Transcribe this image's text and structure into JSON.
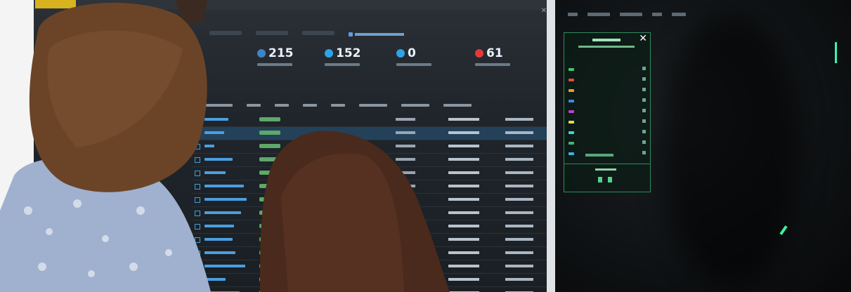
{
  "dashboard": {
    "stats": [
      {
        "value": "215",
        "color": "#3e84c7"
      },
      {
        "value": "152",
        "color": "#2ea3e8"
      },
      {
        "value": "0",
        "color": "#2ea3e8"
      },
      {
        "value": "61",
        "color": "#e23a3a"
      }
    ]
  },
  "colors": {
    "screen_bg": "#1f252b",
    "accent_green": "#2f8b5b",
    "link_blue": "#4a9fe0"
  }
}
